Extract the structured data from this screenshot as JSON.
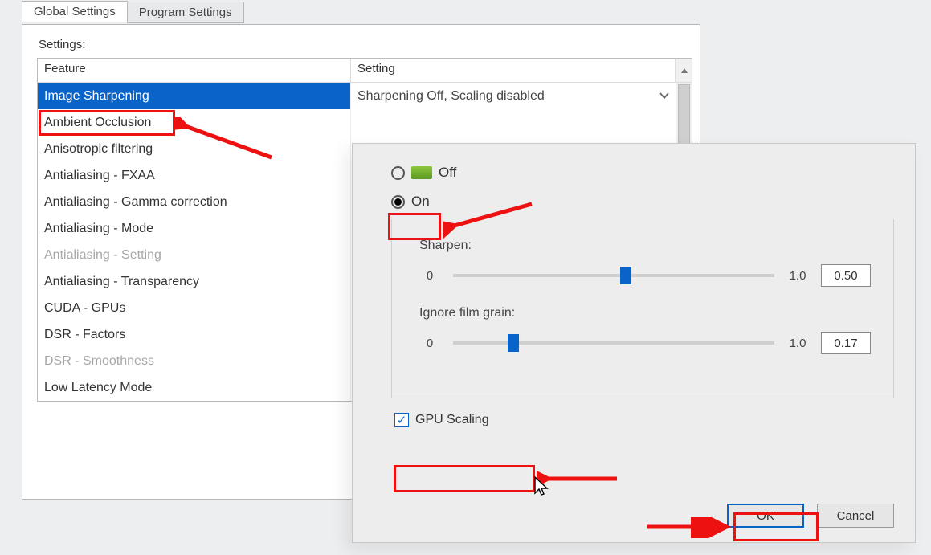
{
  "tabs": {
    "global": "Global Settings",
    "program": "Program Settings"
  },
  "panel": {
    "settings_label": "Settings:",
    "headers": {
      "feature": "Feature",
      "setting": "Setting"
    },
    "features": [
      {
        "label": "Image Sharpening",
        "state": "selected"
      },
      {
        "label": "Ambient Occlusion",
        "state": ""
      },
      {
        "label": "Anisotropic filtering",
        "state": ""
      },
      {
        "label": "Antialiasing - FXAA",
        "state": ""
      },
      {
        "label": "Antialiasing - Gamma correction",
        "state": ""
      },
      {
        "label": "Antialiasing - Mode",
        "state": ""
      },
      {
        "label": "Antialiasing - Setting",
        "state": "disabled"
      },
      {
        "label": "Antialiasing - Transparency",
        "state": ""
      },
      {
        "label": "CUDA - GPUs",
        "state": ""
      },
      {
        "label": "DSR - Factors",
        "state": ""
      },
      {
        "label": "DSR - Smoothness",
        "state": "disabled"
      },
      {
        "label": "Low Latency Mode",
        "state": ""
      }
    ],
    "setting_value": "Sharpening Off, Scaling disabled"
  },
  "popup": {
    "off_label": "Off",
    "on_label": "On",
    "sharpen": {
      "label": "Sharpen:",
      "min": "0",
      "max": "1.0",
      "value": "0.50",
      "pos_percent": 52
    },
    "grain": {
      "label": "Ignore film grain:",
      "min": "0",
      "max": "1.0",
      "value": "0.17",
      "pos_percent": 17
    },
    "gpu_scaling_label": "GPU Scaling",
    "ok_label": "OK",
    "cancel_label": "Cancel"
  }
}
